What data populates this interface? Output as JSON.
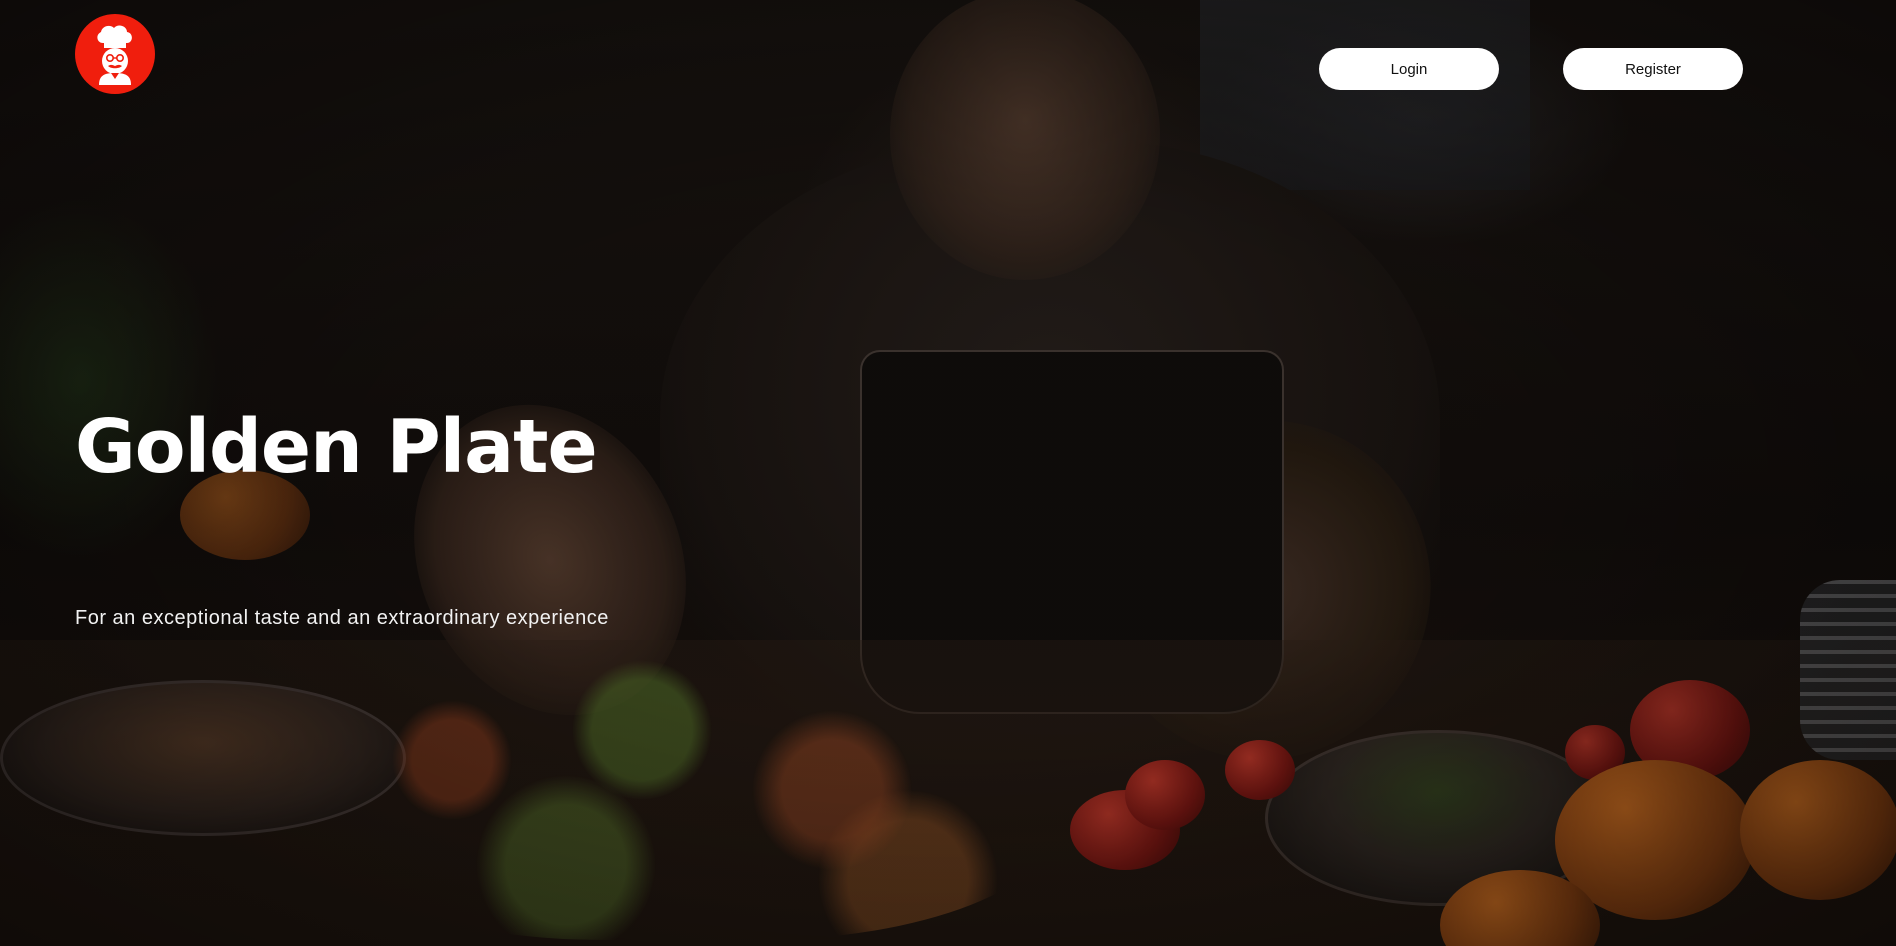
{
  "brand": {
    "logo_icon": "chef-icon",
    "logo_color": "#f01e0d"
  },
  "header": {
    "login_label": "Login",
    "register_label": "Register"
  },
  "hero": {
    "title": "Golden Plate",
    "subtitle": "For an exceptional taste and an extraordinary experience",
    "background_image": "chef-preparing-tacos-photo"
  }
}
